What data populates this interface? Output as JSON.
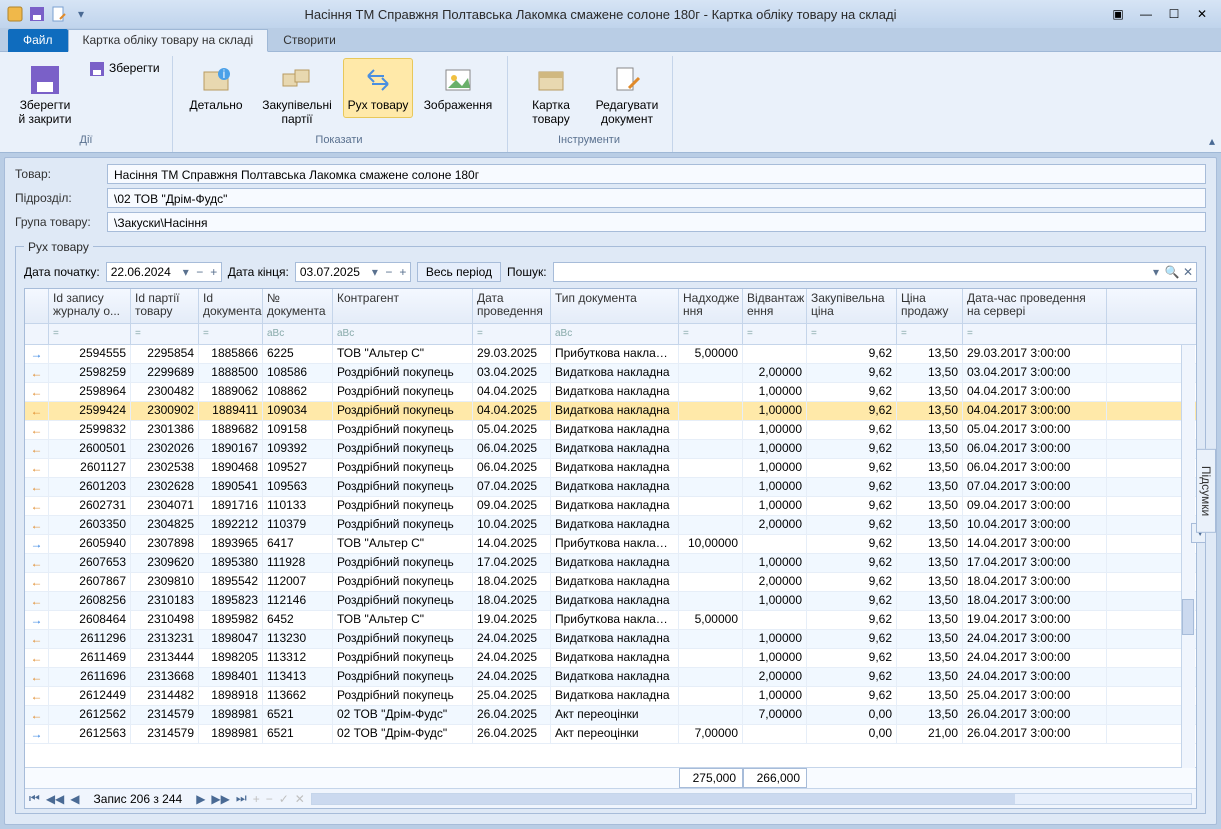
{
  "title": "Насіння ТМ Справжня Полтавська Лакомка смажене солоне 180г - Картка обліку товару на складі",
  "tabs": {
    "file": "Файл",
    "card": "Картка обліку товару на складі",
    "create": "Створити"
  },
  "ribbon": {
    "groups": {
      "actions": {
        "label": "Дії",
        "saveclose": "Зберегти\nй закрити",
        "save": "Зберегти"
      },
      "show": {
        "label": "Показати",
        "detail": "Детально",
        "purchase": "Закупівельні\nпартії",
        "movement": "Рух товару",
        "image": "Зображення"
      },
      "tools": {
        "label": "Інструменти",
        "card": "Картка\nтовару",
        "edit": "Редагувати\nдокумент"
      }
    }
  },
  "fields": {
    "product": {
      "label": "Товар:",
      "value": "Насіння ТМ Справжня Полтавська Лакомка смажене солоне 180г"
    },
    "unit": {
      "label": "Підрозділ:",
      "value": "\\02 ТОВ \"Дрім-Фудс\""
    },
    "group": {
      "label": "Група товару:",
      "value": "\\Закуски\\Насіння"
    }
  },
  "movement": {
    "legend": "Рух товару",
    "dateStartLbl": "Дата початку:",
    "dateStart": "22.06.2024",
    "dateEndLbl": "Дата кінця:",
    "dateEnd": "03.07.2025",
    "fullPeriod": "Весь період",
    "searchLbl": "Пошук:"
  },
  "columns": [
    "",
    "Id запису журналу о...",
    "Id партії товару",
    "Id документа",
    "№ документа",
    "Контрагент",
    "Дата проведення",
    "Тип документа",
    "Надходже\nння",
    "Відвантаж\nення",
    "Закупівельна ціна",
    "Ціна продажу",
    "Дата-час проведення на сервері"
  ],
  "filterGlyphs": [
    "",
    "=",
    "=",
    "=",
    "aBc",
    "aBc",
    "=",
    "aBc",
    "=",
    "=",
    "=",
    "=",
    "="
  ],
  "rows": [
    {
      "dir": "in",
      "j": "2594555",
      "p": "2295854",
      "d": "1885866",
      "n": "6225",
      "c": "ТОВ \"Альтер С\"",
      "dt": "29.03.2025",
      "t": "Прибуткова накладна",
      "in": "5,00000",
      "out": "",
      "bp": "9,62",
      "sp": "13,50",
      "ts": "29.03.2017 3:00:00"
    },
    {
      "dir": "out",
      "j": "2598259",
      "p": "2299689",
      "d": "1888500",
      "n": "108586",
      "c": "Роздрібний покупець",
      "dt": "03.04.2025",
      "t": "Видаткова накладна",
      "in": "",
      "out": "2,00000",
      "bp": "9,62",
      "sp": "13,50",
      "ts": "03.04.2017 3:00:00"
    },
    {
      "dir": "out",
      "j": "2598964",
      "p": "2300482",
      "d": "1889062",
      "n": "108862",
      "c": "Роздрібний покупець",
      "dt": "04.04.2025",
      "t": "Видаткова накладна",
      "in": "",
      "out": "1,00000",
      "bp": "9,62",
      "sp": "13,50",
      "ts": "04.04.2017 3:00:00"
    },
    {
      "dir": "out",
      "sel": true,
      "j": "2599424",
      "p": "2300902",
      "d": "1889411",
      "n": "109034",
      "c": "Роздрібний покупець",
      "dt": "04.04.2025",
      "t": "Видаткова накладна",
      "in": "",
      "out": "1,00000",
      "bp": "9,62",
      "sp": "13,50",
      "ts": "04.04.2017 3:00:00"
    },
    {
      "dir": "out",
      "j": "2599832",
      "p": "2301386",
      "d": "1889682",
      "n": "109158",
      "c": "Роздрібний покупець",
      "dt": "05.04.2025",
      "t": "Видаткова накладна",
      "in": "",
      "out": "1,00000",
      "bp": "9,62",
      "sp": "13,50",
      "ts": "05.04.2017 3:00:00"
    },
    {
      "dir": "out",
      "j": "2600501",
      "p": "2302026",
      "d": "1890167",
      "n": "109392",
      "c": "Роздрібний покупець",
      "dt": "06.04.2025",
      "t": "Видаткова накладна",
      "in": "",
      "out": "1,00000",
      "bp": "9,62",
      "sp": "13,50",
      "ts": "06.04.2017 3:00:00"
    },
    {
      "dir": "out",
      "j": "2601127",
      "p": "2302538",
      "d": "1890468",
      "n": "109527",
      "c": "Роздрібний покупець",
      "dt": "06.04.2025",
      "t": "Видаткова накладна",
      "in": "",
      "out": "1,00000",
      "bp": "9,62",
      "sp": "13,50",
      "ts": "06.04.2017 3:00:00"
    },
    {
      "dir": "out",
      "j": "2601203",
      "p": "2302628",
      "d": "1890541",
      "n": "109563",
      "c": "Роздрібний покупець",
      "dt": "07.04.2025",
      "t": "Видаткова накладна",
      "in": "",
      "out": "1,00000",
      "bp": "9,62",
      "sp": "13,50",
      "ts": "07.04.2017 3:00:00"
    },
    {
      "dir": "out",
      "j": "2602731",
      "p": "2304071",
      "d": "1891716",
      "n": "110133",
      "c": "Роздрібний покупець",
      "dt": "09.04.2025",
      "t": "Видаткова накладна",
      "in": "",
      "out": "1,00000",
      "bp": "9,62",
      "sp": "13,50",
      "ts": "09.04.2017 3:00:00"
    },
    {
      "dir": "out",
      "j": "2603350",
      "p": "2304825",
      "d": "1892212",
      "n": "110379",
      "c": "Роздрібний покупець",
      "dt": "10.04.2025",
      "t": "Видаткова накладна",
      "in": "",
      "out": "2,00000",
      "bp": "9,62",
      "sp": "13,50",
      "ts": "10.04.2017 3:00:00"
    },
    {
      "dir": "in",
      "j": "2605940",
      "p": "2307898",
      "d": "1893965",
      "n": "6417",
      "c": "ТОВ \"Альтер С\"",
      "dt": "14.04.2025",
      "t": "Прибуткова накладна",
      "in": "10,00000",
      "out": "",
      "bp": "9,62",
      "sp": "13,50",
      "ts": "14.04.2017 3:00:00"
    },
    {
      "dir": "out",
      "j": "2607653",
      "p": "2309620",
      "d": "1895380",
      "n": "111928",
      "c": "Роздрібний покупець",
      "dt": "17.04.2025",
      "t": "Видаткова накладна",
      "in": "",
      "out": "1,00000",
      "bp": "9,62",
      "sp": "13,50",
      "ts": "17.04.2017 3:00:00"
    },
    {
      "dir": "out",
      "j": "2607867",
      "p": "2309810",
      "d": "1895542",
      "n": "112007",
      "c": "Роздрібний покупець",
      "dt": "18.04.2025",
      "t": "Видаткова накладна",
      "in": "",
      "out": "2,00000",
      "bp": "9,62",
      "sp": "13,50",
      "ts": "18.04.2017 3:00:00"
    },
    {
      "dir": "out",
      "j": "2608256",
      "p": "2310183",
      "d": "1895823",
      "n": "112146",
      "c": "Роздрібний покупець",
      "dt": "18.04.2025",
      "t": "Видаткова накладна",
      "in": "",
      "out": "1,00000",
      "bp": "9,62",
      "sp": "13,50",
      "ts": "18.04.2017 3:00:00"
    },
    {
      "dir": "in",
      "j": "2608464",
      "p": "2310498",
      "d": "1895982",
      "n": "6452",
      "c": "ТОВ \"Альтер С\"",
      "dt": "19.04.2025",
      "t": "Прибуткова накладна",
      "in": "5,00000",
      "out": "",
      "bp": "9,62",
      "sp": "13,50",
      "ts": "19.04.2017 3:00:00"
    },
    {
      "dir": "out",
      "j": "2611296",
      "p": "2313231",
      "d": "1898047",
      "n": "113230",
      "c": "Роздрібний покупець",
      "dt": "24.04.2025",
      "t": "Видаткова накладна",
      "in": "",
      "out": "1,00000",
      "bp": "9,62",
      "sp": "13,50",
      "ts": "24.04.2017 3:00:00"
    },
    {
      "dir": "out",
      "j": "2611469",
      "p": "2313444",
      "d": "1898205",
      "n": "113312",
      "c": "Роздрібний покупець",
      "dt": "24.04.2025",
      "t": "Видаткова накладна",
      "in": "",
      "out": "1,00000",
      "bp": "9,62",
      "sp": "13,50",
      "ts": "24.04.2017 3:00:00"
    },
    {
      "dir": "out",
      "j": "2611696",
      "p": "2313668",
      "d": "1898401",
      "n": "113413",
      "c": "Роздрібний покупець",
      "dt": "24.04.2025",
      "t": "Видаткова накладна",
      "in": "",
      "out": "2,00000",
      "bp": "9,62",
      "sp": "13,50",
      "ts": "24.04.2017 3:00:00"
    },
    {
      "dir": "out",
      "j": "2612449",
      "p": "2314482",
      "d": "1898918",
      "n": "113662",
      "c": "Роздрібний покупець",
      "dt": "25.04.2025",
      "t": "Видаткова накладна",
      "in": "",
      "out": "1,00000",
      "bp": "9,62",
      "sp": "13,50",
      "ts": "25.04.2017 3:00:00"
    },
    {
      "dir": "out",
      "j": "2612562",
      "p": "2314579",
      "d": "1898981",
      "n": "6521",
      "c": "02 ТОВ \"Дрім-Фудс\"",
      "dt": "26.04.2025",
      "t": "Акт переоцінки",
      "in": "",
      "out": "7,00000",
      "bp": "0,00",
      "sp": "13,50",
      "ts": "26.04.2017 3:00:00"
    },
    {
      "dir": "in",
      "j": "2612563",
      "p": "2314579",
      "d": "1898981",
      "n": "6521",
      "c": "02 ТОВ \"Дрім-Фудс\"",
      "dt": "26.04.2025",
      "t": "Акт переоцінки",
      "in": "7,00000",
      "out": "",
      "bp": "0,00",
      "sp": "21,00",
      "ts": "26.04.2017 3:00:00"
    }
  ],
  "totals": {
    "in": "275,000",
    "out": "266,000"
  },
  "navigator": "Запис 206 з 244",
  "sidetab": "Підсумки"
}
